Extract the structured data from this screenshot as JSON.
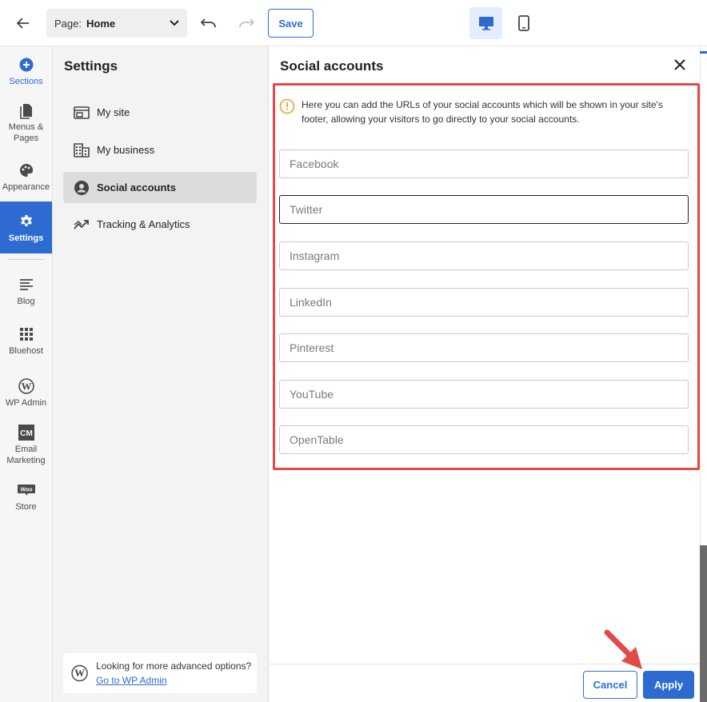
{
  "topbar": {
    "page_label": "Page:",
    "page_value": "Home",
    "save_label": "Save"
  },
  "rail": {
    "items": [
      {
        "label": "Sections",
        "icon": "plus-circle-icon"
      },
      {
        "label": "Menus & Pages",
        "icon": "pages-icon"
      },
      {
        "label": "Appearance",
        "icon": "palette-icon"
      },
      {
        "label": "Settings",
        "icon": "gear-icon"
      },
      {
        "label": "Blog",
        "icon": "blog-icon"
      },
      {
        "label": "Bluehost",
        "icon": "grid-icon"
      },
      {
        "label": "WP Admin",
        "icon": "wordpress-icon"
      },
      {
        "label": "Email Marketing",
        "icon": "cm-icon"
      },
      {
        "label": "Store",
        "icon": "woo-icon"
      }
    ]
  },
  "settings": {
    "title": "Settings",
    "items": [
      {
        "label": "My site",
        "icon": "browser-icon"
      },
      {
        "label": "My business",
        "icon": "building-icon"
      },
      {
        "label": "Social accounts",
        "icon": "user-circle-icon"
      },
      {
        "label": "Tracking & Analytics",
        "icon": "trend-icon"
      }
    ],
    "wp_card": {
      "text": "Looking for more advanced options?",
      "link": "Go to WP Admin"
    }
  },
  "social": {
    "title": "Social accounts",
    "info": "Here you can add the URLs of your social accounts which will be shown in your site's footer, allowing your visitors to go directly to your social accounts.",
    "fields": [
      {
        "placeholder": "Facebook",
        "value": ""
      },
      {
        "placeholder": "Twitter",
        "value": ""
      },
      {
        "placeholder": "Instagram",
        "value": ""
      },
      {
        "placeholder": "LinkedIn",
        "value": ""
      },
      {
        "placeholder": "Pinterest",
        "value": ""
      },
      {
        "placeholder": "YouTube",
        "value": ""
      },
      {
        "placeholder": "OpenTable",
        "value": ""
      }
    ],
    "cancel_label": "Cancel",
    "apply_label": "Apply"
  },
  "colors": {
    "accent": "#2e6bd1",
    "highlight": "#e24a4a",
    "info_icon": "#f0a030"
  }
}
